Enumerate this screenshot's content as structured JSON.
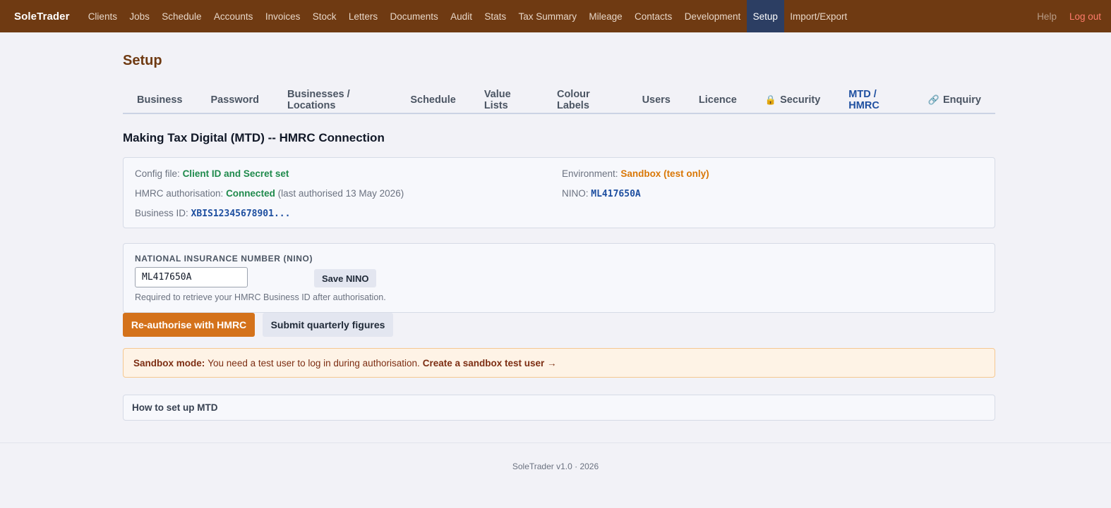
{
  "app": {
    "brand": "SoleTrader",
    "nav": [
      {
        "label": "Clients",
        "active": false
      },
      {
        "label": "Jobs",
        "active": false
      },
      {
        "label": "Schedule",
        "active": false
      },
      {
        "label": "Accounts",
        "active": false
      },
      {
        "label": "Invoices",
        "active": false
      },
      {
        "label": "Stock",
        "active": false
      },
      {
        "label": "Letters",
        "active": false
      },
      {
        "label": "Documents",
        "active": false
      },
      {
        "label": "Audit",
        "active": false
      },
      {
        "label": "Stats",
        "active": false
      },
      {
        "label": "Tax Summary",
        "active": false
      },
      {
        "label": "Mileage",
        "active": false
      },
      {
        "label": "Contacts",
        "active": false
      },
      {
        "label": "Development",
        "active": false
      },
      {
        "label": "Setup",
        "active": true
      },
      {
        "label": "Import/Export",
        "active": false
      }
    ],
    "help": "Help",
    "logout": "Log out"
  },
  "page": {
    "title": "Setup",
    "tabs": [
      {
        "label": "Business",
        "icon": "",
        "active": false
      },
      {
        "label": "Password",
        "icon": "",
        "active": false
      },
      {
        "label": "Businesses / Locations",
        "icon": "",
        "active": false
      },
      {
        "label": "Schedule",
        "icon": "",
        "active": false
      },
      {
        "label": "Value Lists",
        "icon": "",
        "active": false
      },
      {
        "label": "Colour Labels",
        "icon": "",
        "active": false
      },
      {
        "label": "Users",
        "icon": "",
        "active": false
      },
      {
        "label": "Licence",
        "icon": "",
        "active": false
      },
      {
        "label": "Security",
        "icon": "🔒",
        "active": false
      },
      {
        "label": "MTD / HMRC",
        "icon": "",
        "active": true
      },
      {
        "label": "Enquiry",
        "icon": "🔗",
        "active": false
      }
    ]
  },
  "mtd": {
    "heading": "Making Tax Digital (MTD) -- HMRC Connection",
    "config_label": "Config file:",
    "config_value": "Client ID and Secret set",
    "auth_label": "HMRC authorisation:",
    "auth_value": "Connected",
    "auth_note": "(last authorised 13 May 2026)",
    "business_id_label": "Business ID:",
    "business_id_value": "XBIS12345678901...",
    "env_label": "Environment:",
    "env_value": "Sandbox (test only)",
    "nino_label": "NINO:",
    "nino_value": "ML417650A",
    "colors": {
      "connected": "#1f8a4c",
      "sandbox": "#d97706",
      "accent": "#d4721b",
      "nav_bg": "#6f3a12"
    }
  },
  "nino_form": {
    "label": "NATIONAL INSURANCE NUMBER (NINO)",
    "input_value": "ML417650A",
    "save_label": "Save NINO",
    "help": "Required to retrieve your HMRC Business ID after authorisation."
  },
  "actions": {
    "reauth": "Re-authorise with HMRC",
    "submit": "Submit quarterly figures"
  },
  "sandbox": {
    "strong": "Sandbox mode:",
    "text": "You need a test user to log in during authorisation.",
    "link": "Create a sandbox test user →"
  },
  "howto": {
    "label": "How to set up MTD"
  },
  "footer": {
    "text": "SoleTrader v1.0  ·  2026"
  }
}
